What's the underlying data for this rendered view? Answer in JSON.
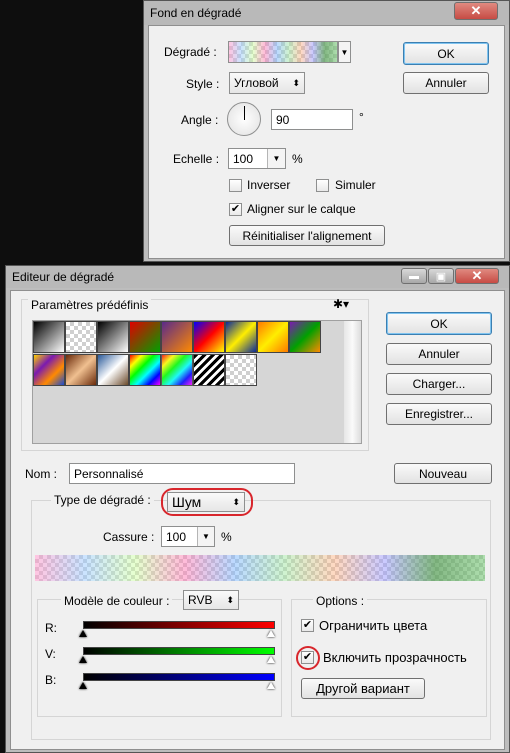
{
  "dialog1": {
    "title": "Fond en dégradé",
    "gradient_label": "Dégradé :",
    "style_label": "Style :",
    "style_value": "Угловой",
    "angle_label": "Angle :",
    "angle_value": "90",
    "angle_unit": "°",
    "scale_label": "Echelle :",
    "scale_value": "100",
    "scale_unit": "%",
    "invert_label": "Inverser",
    "invert_checked": false,
    "simulate_label": "Simuler",
    "simulate_checked": false,
    "align_label": "Aligner sur le calque",
    "align_checked": true,
    "reset_align_label": "Réinitialiser l'alignement",
    "ok_label": "OK",
    "cancel_label": "Annuler"
  },
  "dialog2": {
    "title": "Editeur de dégradé",
    "presets_label": "Paramètres prédéfinis",
    "ok_label": "OK",
    "cancel_label": "Annuler",
    "load_label": "Charger...",
    "save_label": "Enregistrer...",
    "name_label": "Nom :",
    "name_value": "Personnalisé",
    "new_label": "Nouveau",
    "type_label": "Type de dégradé :",
    "type_value": "Шум",
    "roughness_label": "Cassure :",
    "roughness_value": "100",
    "roughness_unit": "%",
    "color_model_label": "Modèle de couleur :",
    "color_model_value": "RVB",
    "channels": [
      {
        "label": "R:",
        "color": "#ff0000"
      },
      {
        "label": "V:",
        "color": "#00ff00"
      },
      {
        "label": "B:",
        "color": "#0000ff"
      }
    ],
    "options_label": "Options :",
    "restrict_colors_label": "Ограничить цвета",
    "restrict_colors_checked": true,
    "add_transparency_label": "Включить прозрачность",
    "add_transparency_checked": true,
    "randomize_label": "Другой вариант"
  },
  "presets": [
    {
      "name": "foreground-to-background",
      "colors": [
        "#000000",
        "#ffffff"
      ]
    },
    {
      "name": "foreground-to-transparent",
      "colors": [
        "#000000",
        "transparent"
      ]
    },
    {
      "name": "black-white",
      "colors": [
        "#000000",
        "#ffffff"
      ]
    },
    {
      "name": "red-green",
      "colors": [
        "#e00000",
        "#00a000"
      ]
    },
    {
      "name": "violet-orange",
      "colors": [
        "#5a2a8a",
        "#ff8a00"
      ]
    },
    {
      "name": "blue-red-yellow",
      "colors": [
        "#0000ff",
        "#ff0000",
        "#ffff00"
      ]
    },
    {
      "name": "blue-yellow-blue",
      "colors": [
        "#0a2a9a",
        "#ffee00",
        "#0a2a9a"
      ]
    },
    {
      "name": "orange-yellow-orange",
      "colors": [
        "#ff7a00",
        "#ffee00",
        "#ff7a00"
      ]
    },
    {
      "name": "violet-green-orange",
      "colors": [
        "#7a1ab0",
        "#00a000",
        "#ff8a00"
      ]
    },
    {
      "name": "yellow-violet-orange-blue",
      "colors": [
        "#ffd000",
        "#7a1ab0",
        "#ff8a00",
        "#1a4ad0"
      ]
    },
    {
      "name": "copper",
      "colors": [
        "#6a2a0a",
        "#f0c090",
        "#6a2a0a"
      ]
    },
    {
      "name": "chrome",
      "colors": [
        "#2a5a9a",
        "#ffffff",
        "#6a4a2a"
      ]
    },
    {
      "name": "spectrum",
      "colors": [
        "#ff0000",
        "#ffff00",
        "#00ff00",
        "#00ffff",
        "#0000ff",
        "#ff00ff"
      ]
    },
    {
      "name": "transparent-rainbow",
      "colors": [
        "#ff0000",
        "#ffff00",
        "#00ff00",
        "#00ffff",
        "#0000ff",
        "#ff00ff"
      ]
    },
    {
      "name": "transparent-stripes",
      "colors": [
        "#000000",
        "#ffffff"
      ]
    },
    {
      "name": "transparent-checker",
      "colors": [
        "transparent"
      ]
    }
  ],
  "icons": {
    "close": "close-icon",
    "minimize": "minimize-icon",
    "maximize": "maximize-icon",
    "gear": "gear-icon",
    "dropdown": "chevron-down-icon",
    "checkmark": "checkmark-icon"
  },
  "colors": {
    "close_button": "#c74b44",
    "highlight_circle": "#d8262c",
    "default_button_border": "#3c7fb1"
  }
}
